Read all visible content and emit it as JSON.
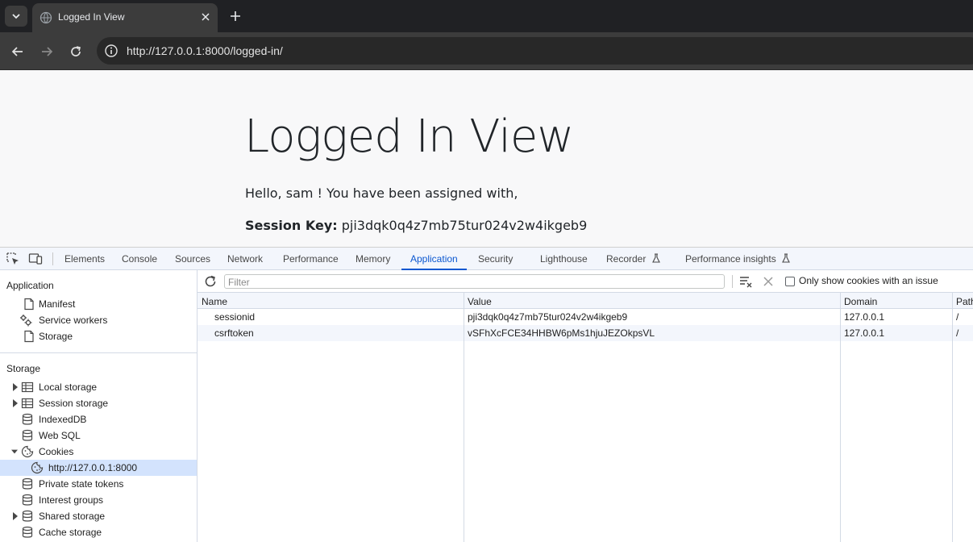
{
  "browser": {
    "tab_title": "Logged In View",
    "url": "http://127.0.0.1:8000/logged-in/"
  },
  "page": {
    "title": "Logged In View",
    "greeting": "Hello, sam ! You have been assigned with,",
    "session_label": "Session Key:",
    "session_value": "pji3dqk0q4z7mb75tur024v2w4ikgeb9"
  },
  "devtools": {
    "tabs": [
      {
        "label": "Elements"
      },
      {
        "label": "Console"
      },
      {
        "label": "Sources"
      },
      {
        "label": "Network"
      },
      {
        "label": "Performance"
      },
      {
        "label": "Memory"
      },
      {
        "label": "Application",
        "active": true
      },
      {
        "label": "Security"
      },
      {
        "label": "Lighthouse"
      },
      {
        "label": "Recorder"
      },
      {
        "label": "Performance insights"
      }
    ],
    "sidebar": {
      "application_header": "Application",
      "application_items": [
        "Manifest",
        "Service workers",
        "Storage"
      ],
      "storage_header": "Storage",
      "storage_items": [
        "Local storage",
        "Session storage",
        "IndexedDB",
        "Web SQL",
        "Cookies",
        "http://127.0.0.1:8000",
        "Private state tokens",
        "Interest groups",
        "Shared storage",
        "Cache storage"
      ]
    },
    "cookies": {
      "filter_placeholder": "Filter",
      "only_issue_label": "Only show cookies with an issue",
      "columns": [
        "Name",
        "Value",
        "Domain",
        "Path"
      ],
      "rows": [
        {
          "name": "sessionid",
          "value": "pji3dqk0q4z7mb75tur024v2w4ikgeb9",
          "domain": "127.0.0.1",
          "path": "/"
        },
        {
          "name": "csrftoken",
          "value": "vSFhXcFCE34HHBW6pMs1hjuJEZOkpsVL",
          "domain": "127.0.0.1",
          "path": "/"
        }
      ]
    }
  },
  "colors": {
    "accent": "#0b57d0",
    "selected_bg": "#d3e3fd",
    "chrome_dark": "#202124"
  }
}
